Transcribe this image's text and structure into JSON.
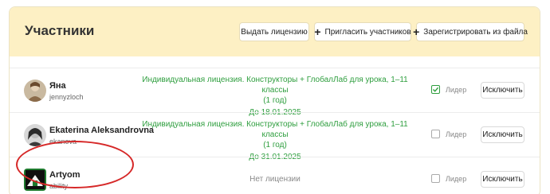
{
  "header": {
    "title": "Участники",
    "issue_license_label": "Выдать лицензию",
    "invite_label": "Пригласить участников",
    "register_label": "Зарегистрировать из файла"
  },
  "members": [
    {
      "name": "Яна",
      "login": "jennyzloch",
      "license_line1": "Индивидуальная лицензия. Конструкторы + ГлобалЛаб для урока, 1–11 классы",
      "license_line2": "(1 год)",
      "license_until": "До 18.01.2025",
      "leader_label": "Лидер",
      "leader_checked": true,
      "exclude_label": "Исключить"
    },
    {
      "name": "Ekaterina Aleksandrovna",
      "login": "ekanova",
      "license_line1": "Индивидуальная лицензия. Конструкторы + ГлобалЛаб для урока, 1–11 классы",
      "license_line2": "(1 год)",
      "license_until": "До 31.01.2025",
      "leader_label": "Лидер",
      "leader_checked": false,
      "exclude_label": "Исключить"
    },
    {
      "name": "Artyom",
      "login": "ability",
      "no_license": "Нет лицензии",
      "leader_label": "Лидер",
      "leader_checked": false,
      "exclude_label": "Исключить"
    }
  ],
  "colors": {
    "header_bg": "#fdf0c4",
    "license_green": "#2e9e3e",
    "annotation_red": "#d62828"
  }
}
